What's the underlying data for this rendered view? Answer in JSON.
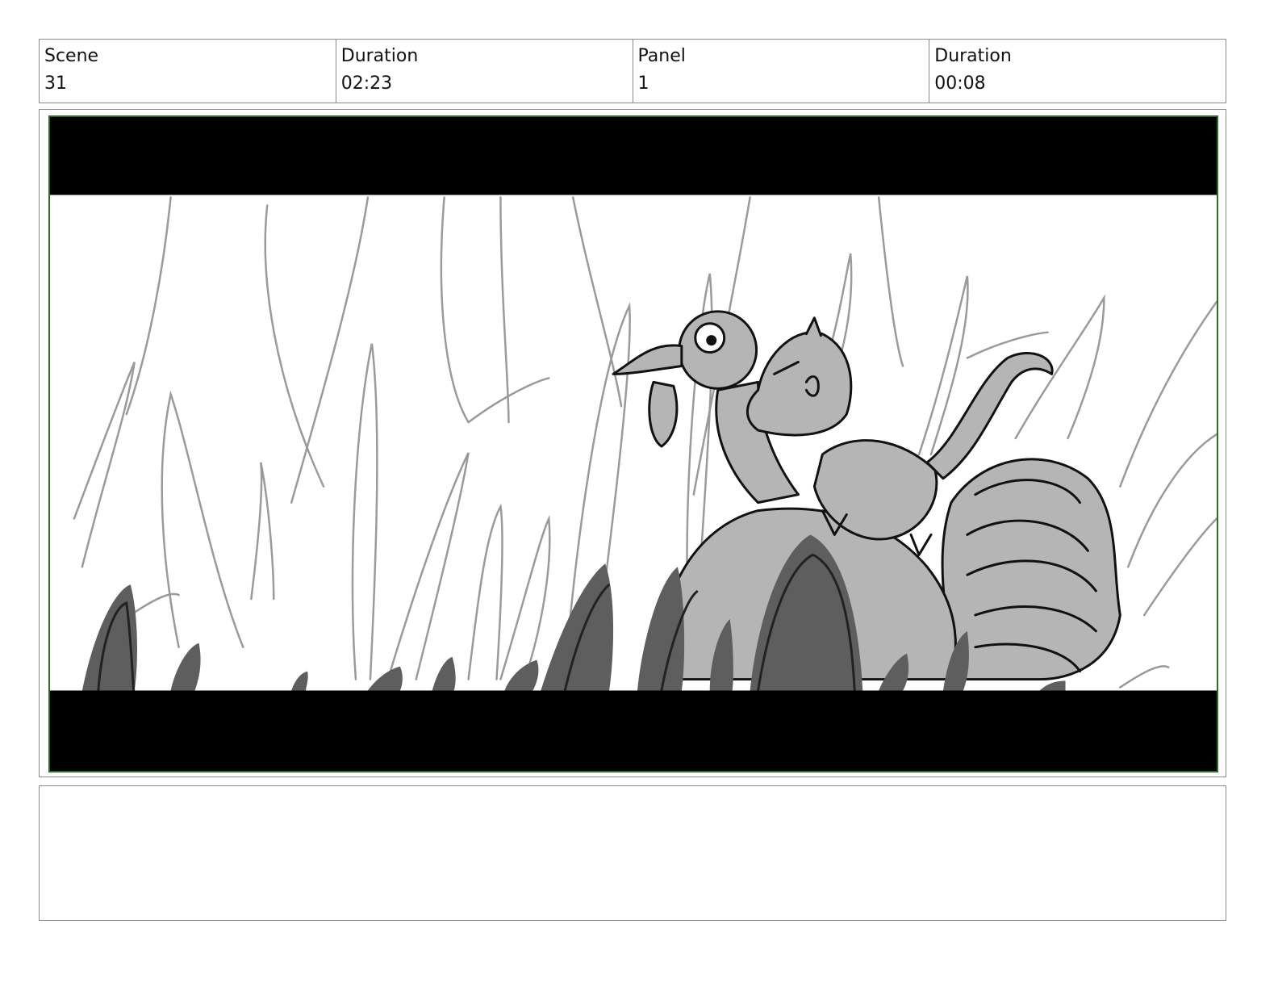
{
  "header": {
    "scene_label": "Scene",
    "scene_value": "31",
    "scene_duration_label": "Duration",
    "scene_duration_value": "02:23",
    "panel_label": "Panel",
    "panel_value": "1",
    "panel_duration_label": "Duration",
    "panel_duration_value": "00:08"
  },
  "panel": {
    "letterbox_color": "#000000",
    "frame_border_color": "#2a6e2a"
  },
  "notes": {
    "text": ""
  }
}
